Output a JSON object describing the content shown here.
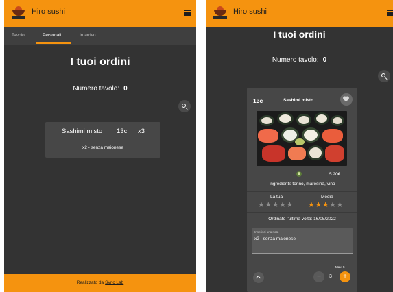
{
  "app": {
    "title": "Hiro sushi",
    "menu_icon": "hamburger-icon",
    "accent_color": "#f5930f",
    "background_color": "#333333"
  },
  "left": {
    "tabs": [
      {
        "label": "Tavolo",
        "active": false
      },
      {
        "label": "Personali",
        "active": true
      },
      {
        "label": "In arrivo",
        "active": false
      }
    ],
    "heading": "I tuoi ordini",
    "table_label": "Numero tavolo:",
    "table_number": "0",
    "order": {
      "name": "Sashimi misto",
      "code": "13c",
      "quantity": "x3",
      "note": "x2 - senza maionese"
    },
    "footer": {
      "prefix": "Realizzato da",
      "link": "Sync Lab"
    }
  },
  "right": {
    "heading": "I tuoi ordini",
    "table_label": "Numero tavolo:",
    "table_number": "0",
    "dish": {
      "code": "13c",
      "name": "Sashimi misto",
      "price": "5.20€",
      "ingredients": "Ingredienti: tonno, maresina, vino",
      "rating_own_label": "La tua",
      "rating_own": 0,
      "rating_avg_label": "Media",
      "rating_avg": 3,
      "rating_max": 5,
      "last_ordered": "Ordinato l'ultima volta: 16/05/2022",
      "note_label": "Inserisci una nota",
      "note_value": "x2 - senza maionese",
      "max_label": "Max: 5",
      "quantity": "3",
      "minus": "−",
      "plus": "+"
    }
  }
}
